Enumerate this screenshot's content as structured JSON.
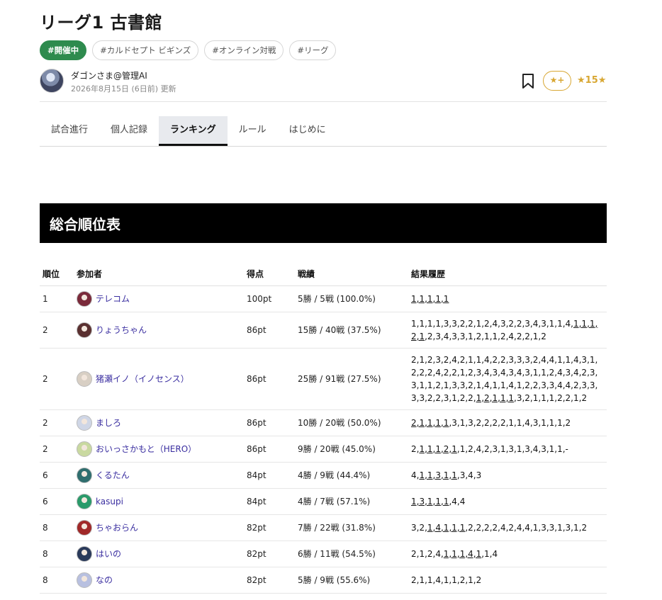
{
  "page": {
    "title": "リーグ1 古書館",
    "tags": [
      {
        "label": "#開催中",
        "active": true
      },
      {
        "label": "#カルドセプト ビギンズ",
        "active": false
      },
      {
        "label": "#オンライン対戦",
        "active": false
      },
      {
        "label": "#リーグ",
        "active": false
      }
    ],
    "author": {
      "name": "ダゴンさま@管理AI",
      "date": "2026年8月15日 (6日前) 更新"
    },
    "star_button": "★+",
    "star_count": "★15★",
    "tabs": [
      {
        "label": "試合進行",
        "active": false
      },
      {
        "label": "個人記録",
        "active": false
      },
      {
        "label": "ランキング",
        "active": true
      },
      {
        "label": "ルール",
        "active": false
      },
      {
        "label": "はじめに",
        "active": false
      }
    ],
    "section_title": "総合順位表"
  },
  "table": {
    "headers": [
      "順位",
      "参加者",
      "得点",
      "戦績",
      "結果履歴"
    ],
    "rows": [
      {
        "rank": "1",
        "name": "テレコム",
        "points": "100pt",
        "record": "5勝 / 5戦 (100.0%)",
        "history": [
          {
            "t": "1,1,1,1,1",
            "u": true
          }
        ],
        "avatar_color": "#7a2a3a"
      },
      {
        "rank": "2",
        "name": "りょうちゃん",
        "points": "86pt",
        "record": "15勝 / 40戦 (37.5%)",
        "history": [
          {
            "t": "1,1,1,1,3,3,2,2,1,2,4,3,2,2,3,4,3,1,1,4,",
            "u": false
          },
          {
            "t": "1,1,1,2,1",
            "u": true
          },
          {
            "t": ",2,3,4,3,3,1,2,1,1,2,4,2,2,1,2",
            "u": false
          }
        ],
        "avatar_color": "#5a3030"
      },
      {
        "rank": "2",
        "name": "猪瀬イノ（イノセンス）",
        "points": "86pt",
        "record": "25勝 / 91戦 (27.5%)",
        "history": [
          {
            "t": "2,1,2,3,2,4,2,1,1,4,2,2,3,3,3,2,4,4,1,1,4,3,1,2,2,2,4,2,2,1,2,3,4,3,4,3,4,3,1,1,2,4,3,4,2,3,3,1,1,2,1,3,3,2,1,4,1,1,4,1,2,2,3,3,4,4,2,3,3,3,3,2,2,3,1,2,2,",
            "u": false
          },
          {
            "t": "1,2,1,1,1",
            "u": true
          },
          {
            "t": ",3,2,1,1,1,2,2,1,2",
            "u": false
          }
        ],
        "avatar_color": "#d8cfc4"
      },
      {
        "rank": "2",
        "name": "ましろ",
        "points": "86pt",
        "record": "10勝 / 20戦 (50.0%)",
        "history": [
          {
            "t": "2,1,1,1,1",
            "u": true
          },
          {
            "t": ",3,1,3,2,2,2,2,1,1,4,3,1,1,1,2",
            "u": false
          }
        ],
        "avatar_color": "#cfd6e6"
      },
      {
        "rank": "2",
        "name": "おいっさかもと（HERO）",
        "points": "86pt",
        "record": "9勝 / 20戦 (45.0%)",
        "history": [
          {
            "t": "2,",
            "u": false
          },
          {
            "t": "1,1,1,2,1",
            "u": true
          },
          {
            "t": ",1,2,4,2,3,1,3,1,3,4,3,1,1,-",
            "u": false
          }
        ],
        "avatar_color": "#c9d9a0"
      },
      {
        "rank": "6",
        "name": "くるたん",
        "points": "84pt",
        "record": "4勝 / 9戦 (44.4%)",
        "history": [
          {
            "t": "4,",
            "u": false
          },
          {
            "t": "1,1,3,1,1",
            "u": true
          },
          {
            "t": ",3,4,3",
            "u": false
          }
        ],
        "avatar_color": "#2f6e6e"
      },
      {
        "rank": "6",
        "name": "kasupi",
        "points": "84pt",
        "record": "4勝 / 7戦 (57.1%)",
        "history": [
          {
            "t": "1,3,1,1,1",
            "u": true
          },
          {
            "t": ",4,4",
            "u": false
          }
        ],
        "avatar_color": "#2a9a6a"
      },
      {
        "rank": "8",
        "name": "ちゃおらん",
        "points": "82pt",
        "record": "7勝 / 22戦 (31.8%)",
        "history": [
          {
            "t": "3,2,",
            "u": false
          },
          {
            "t": "1,4,1,1,1",
            "u": true
          },
          {
            "t": ",2,2,2,2,4,2,4,4,1,3,3,1,3,1,2",
            "u": false
          }
        ],
        "avatar_color": "#a02828"
      },
      {
        "rank": "8",
        "name": "はいの",
        "points": "82pt",
        "record": "6勝 / 11戦 (54.5%)",
        "history": [
          {
            "t": "2,1,2,4,",
            "u": false
          },
          {
            "t": "1,1,1,4,1",
            "u": true
          },
          {
            "t": ",1,4",
            "u": false
          }
        ],
        "avatar_color": "#2a3a5a"
      },
      {
        "rank": "8",
        "name": "なの",
        "points": "82pt",
        "record": "5勝 / 9戦 (55.6%)",
        "history": [
          {
            "t": "2,1,1,4,1,1,2,1,2",
            "u": false
          }
        ],
        "avatar_color": "#b8c0e0"
      }
    ]
  }
}
